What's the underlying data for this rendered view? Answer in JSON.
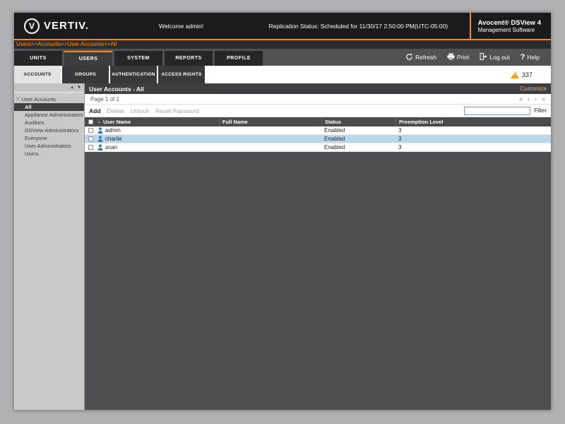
{
  "colors": {
    "accent_orange": "#f68b1e",
    "breadcrumb_orange": "#f7941d",
    "selected_row_blue": "#b9d7ec",
    "alert_orange": "#f2a31b",
    "user_icon_blue": "#3779ab"
  },
  "icons": {
    "logo_initial": "V",
    "help_glyph": "?",
    "first_page": "«",
    "prev_page": "‹",
    "next_page": "›",
    "last_page": "»",
    "scroll_up": "▲",
    "scroll_down": "▼",
    "tree_expander": "▽",
    "sort_asc": "▲"
  },
  "topbar": {
    "logo_text": "VERTIV.",
    "welcome": "Welcome admin!",
    "replication_status": "Replication Status: Scheduled for 11/30/17 2:50:00 PM(UTC-05:00)",
    "brand_title": "Avocent® DSView 4",
    "brand_subtitle": "Management Software"
  },
  "breadcrumb": "Users>>Accounts>>User Accounts>>All",
  "tabs": [
    {
      "label": "UNITS"
    },
    {
      "label": "USERS"
    },
    {
      "label": "SYSTEM"
    },
    {
      "label": "REPORTS"
    },
    {
      "label": "PROFILE"
    }
  ],
  "actions": {
    "refresh": "Refresh",
    "print": "Print",
    "logout": "Log out",
    "help": "Help"
  },
  "subtabs": [
    {
      "label": "ACCOUNTS"
    },
    {
      "label": "GROUPS"
    },
    {
      "label": "AUTHENTICATION"
    },
    {
      "label": "ACCESS RIGHTS"
    }
  ],
  "alert_count": "337",
  "sidebar": {
    "root_label": "User Accounts",
    "items": [
      {
        "label": "All",
        "selected": true
      },
      {
        "label": "Appliance Administrators"
      },
      {
        "label": "Auditors"
      },
      {
        "label": "DSView Administrators"
      },
      {
        "label": "Everyone"
      },
      {
        "label": "User Administrators"
      },
      {
        "label": "Users"
      }
    ]
  },
  "content": {
    "title": "User Accounts - All",
    "customize_label": "Customize",
    "page_info": "Page 1 of 1",
    "toolbar": {
      "add": "Add",
      "delete": "Delete",
      "unlock": "Unlock",
      "reset_password": "Reset Password"
    },
    "filter_label": "Filter",
    "filter_value": "",
    "table": {
      "columns": [
        "User Name",
        "Full Name",
        "Status",
        "Preemption Level"
      ],
      "rows": [
        {
          "user": "admin",
          "full_name": "",
          "status": "Enabled",
          "preemption": "3"
        },
        {
          "user": "charlie",
          "full_name": "",
          "status": "Enabled",
          "preemption": "3"
        },
        {
          "user": "scan",
          "full_name": "",
          "status": "Enabled",
          "preemption": "3"
        }
      ]
    }
  }
}
